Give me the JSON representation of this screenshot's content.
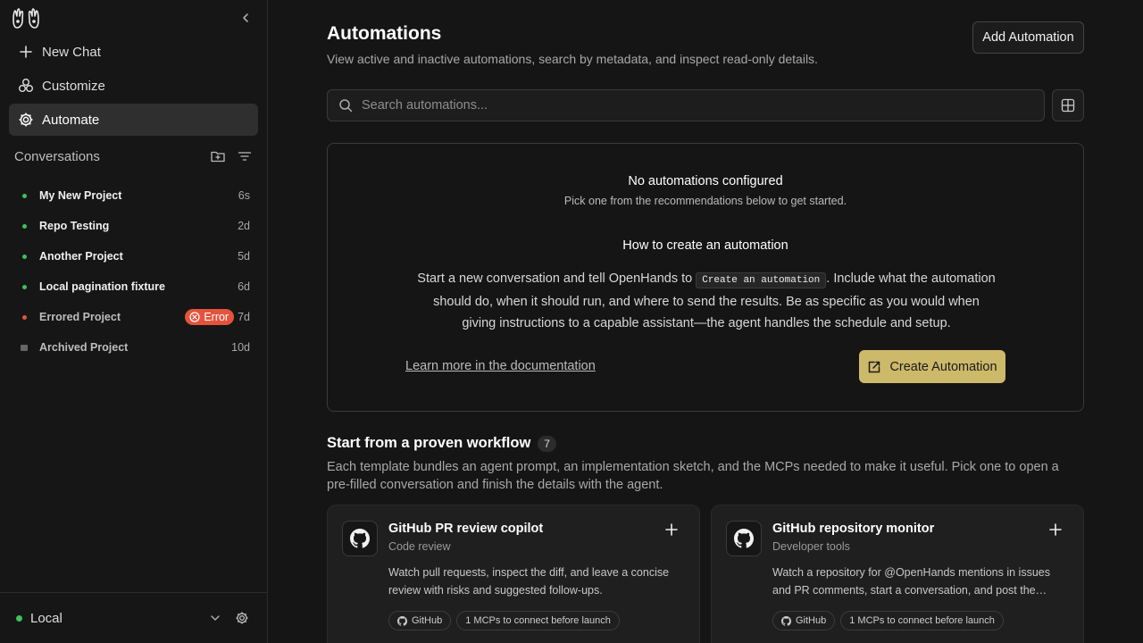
{
  "sidebar": {
    "nav": {
      "new_chat": "New Chat",
      "customize": "Customize",
      "automate": "Automate"
    },
    "conversations_label": "Conversations",
    "conversations": [
      {
        "name": "My New Project",
        "time": "6s",
        "status": "active"
      },
      {
        "name": "Repo Testing",
        "time": "2d",
        "status": "active"
      },
      {
        "name": "Another Project",
        "time": "5d",
        "status": "active"
      },
      {
        "name": "Local pagination fixture",
        "time": "6d",
        "status": "active"
      },
      {
        "name": "Errored Project",
        "time": "7d",
        "status": "error",
        "badge": "Error"
      },
      {
        "name": "Archived Project",
        "time": "10d",
        "status": "archived"
      }
    ],
    "footer": {
      "runtime": "Local"
    }
  },
  "main": {
    "title": "Automations",
    "subtitle": "View active and inactive automations, search by metadata, and inspect read-only details.",
    "add_button": "Add Automation",
    "search_placeholder": "Search automations...",
    "empty": {
      "title": "No automations configured",
      "subtitle": "Pick one from the recommendations below to get started.",
      "how_title": "How to create an automation",
      "body_pre": "Start a new conversation and tell OpenHands to",
      "body_code": "Create an automation",
      "body_post": ". Include what the automation should do, when it should run, and where to send the results. Be as specific as you would when giving instructions to a capable assistant—the agent handles the schedule and setup.",
      "learn_link": "Learn more in the documentation",
      "create_button": "Create Automation"
    },
    "workflows": {
      "title": "Start from a proven workflow",
      "count": "7",
      "description": "Each template bundles an agent prompt, an implementation sketch, and the MCPs needed to make it useful. Pick one to open a pre-filled conversation and finish the details with the agent.",
      "cards": [
        {
          "title": "GitHub PR review copilot",
          "category": "Code review",
          "description": "Watch pull requests, inspect the diff, and leave a concise review with risks and suggested follow-ups.",
          "chip_github": "GitHub",
          "chip_mcp": "1 MCPs to connect before launch"
        },
        {
          "title": "GitHub repository monitor",
          "category": "Developer tools",
          "description": "Watch a repository for @OpenHands mentions in issues and PR comments, start a conversation, and post the agent's response back.",
          "chip_github": "GitHub",
          "chip_mcp": "1 MCPs to connect before launch"
        }
      ]
    }
  },
  "colors": {
    "background": "#151515",
    "accent": "#cdb96a",
    "active_dot": "#3cc35a",
    "error": "#e5533d"
  }
}
